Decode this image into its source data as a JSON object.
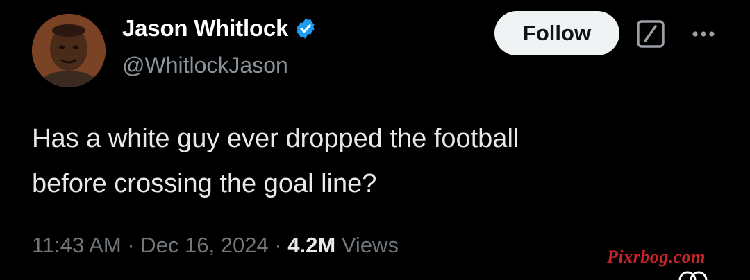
{
  "author": {
    "display_name": "Jason Whitlock",
    "handle": "@WhitlockJason",
    "verified": true
  },
  "actions": {
    "follow_label": "Follow",
    "grok_icon": "grok-slash-icon",
    "more_icon": "more-dots-icon"
  },
  "tweet": {
    "text_line1": "Has a white guy ever dropped the football",
    "text_line2": "before crossing the goal line?"
  },
  "meta": {
    "time": "11:43 AM",
    "separator": "·",
    "date": "Dec 16, 2024",
    "views_count": "4.2M",
    "views_label": "Views"
  },
  "watermark": {
    "text": "Pixrbog.com",
    "color": "#c9232a"
  },
  "colors": {
    "background": "#000000",
    "text": "#e7e9ea",
    "secondary": "#71767b",
    "verified_blue": "#1d9bf0",
    "follow_bg": "#eff3f4"
  }
}
